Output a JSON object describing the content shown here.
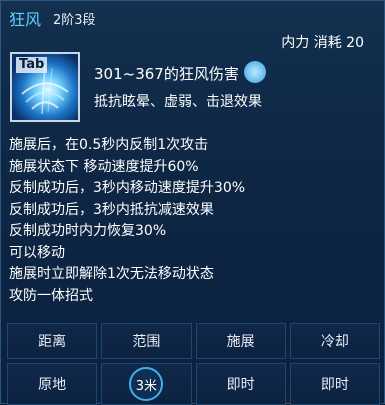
{
  "skill": {
    "name": "狂风",
    "level": "2阶3段",
    "cost": "内力 消耗 20",
    "hotkey": "Tab",
    "damage": "301~367的狂风伤害",
    "resist": "抵抗眩晕、虚弱、击退效果"
  },
  "effects": [
    "施展后，在0.5秒内反制1次攻击",
    "施展状态下 移动速度提升60%",
    "反制成功后，3秒内移动速度提升30%",
    "反制成功后，3秒内抵抗减速效果",
    "反制成功时内力恢复30%",
    "可以移动",
    "施展时立即解除1次无法移动状态",
    "攻防一体招式"
  ],
  "stats": {
    "headers": [
      "距离",
      "范围",
      "施展",
      "冷却"
    ],
    "values": [
      "原地",
      "3米",
      "即时",
      "即时"
    ]
  },
  "colors": {
    "accent": "#5fd2ff",
    "background": "#0b1d33"
  }
}
